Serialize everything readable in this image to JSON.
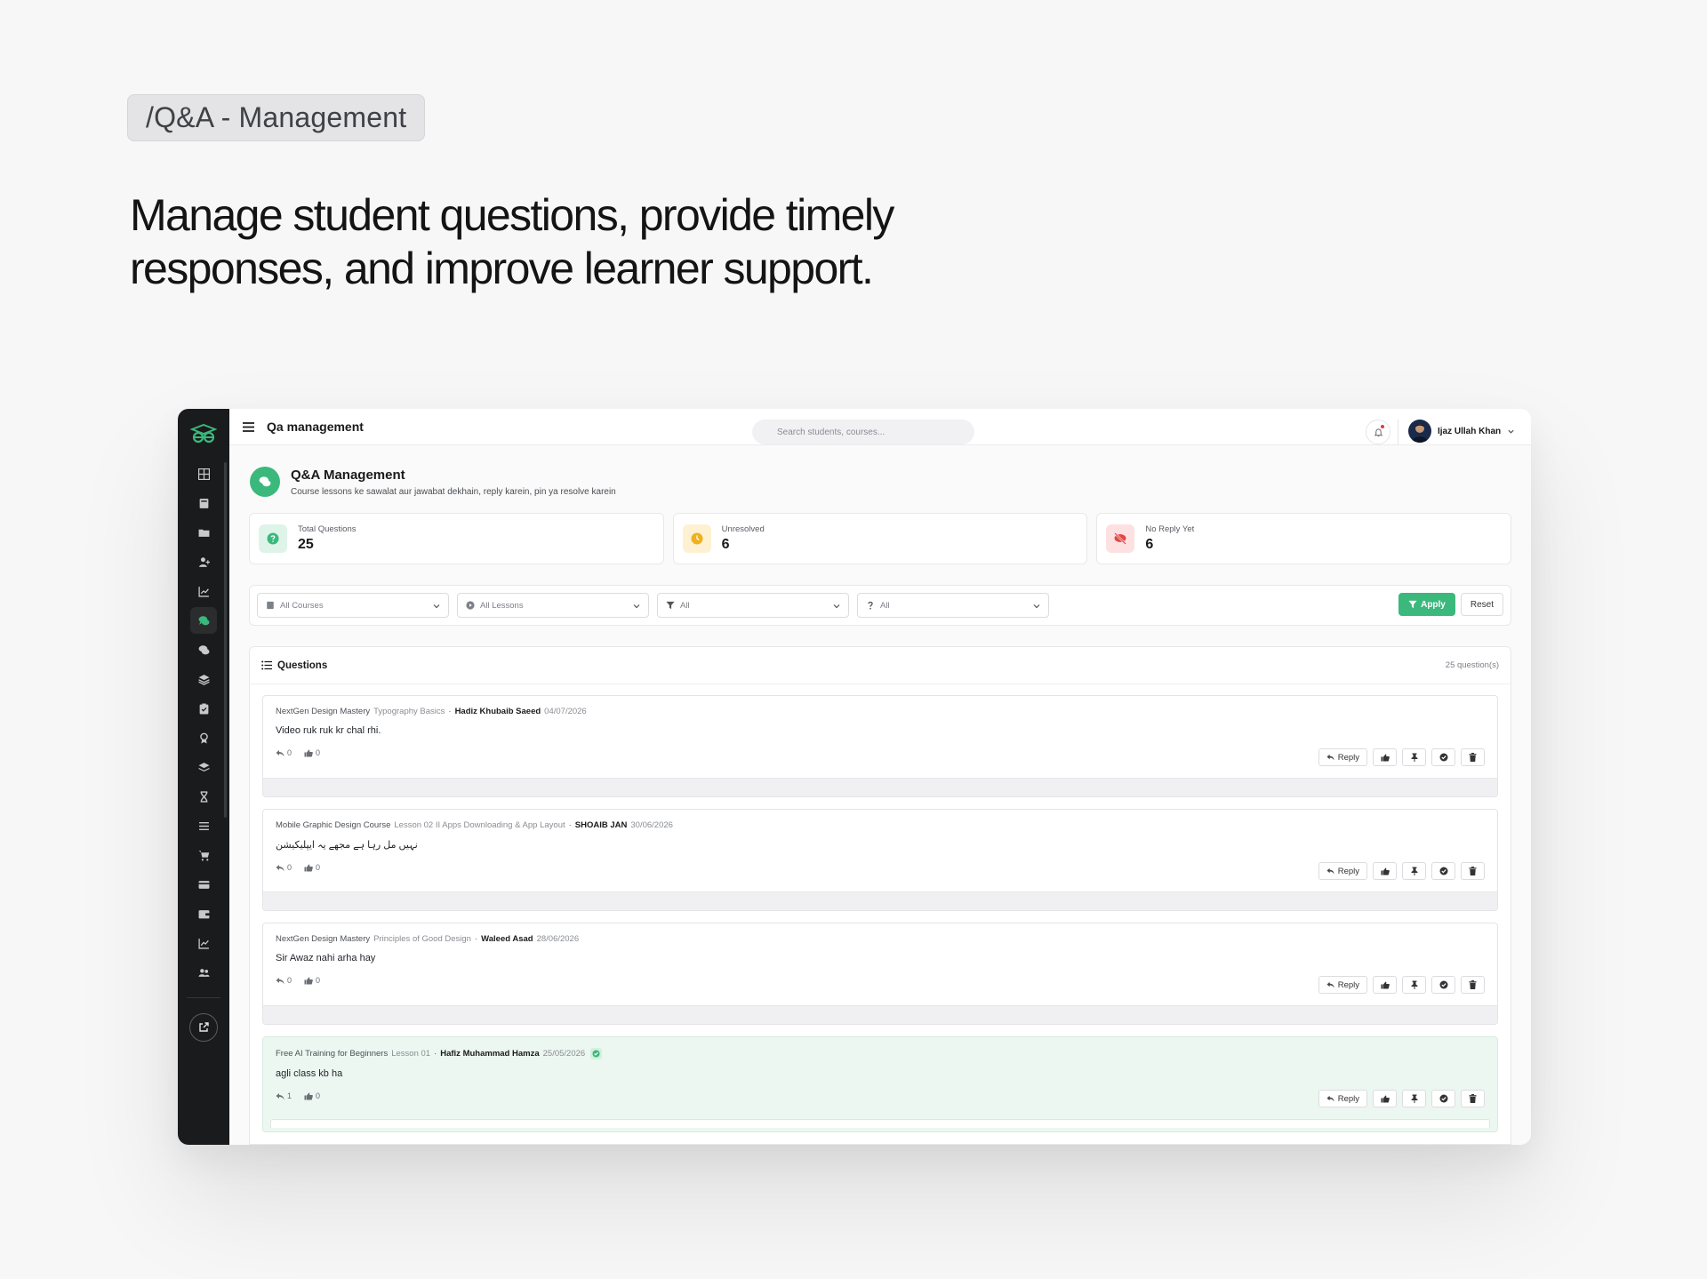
{
  "marketing": {
    "tag": "/Q&A - Management",
    "headline": "Manage student questions, provide timely responses, and improve learner support."
  },
  "topbar": {
    "title": "Qa management",
    "search_placeholder": "Search students, courses...",
    "user_name": "Ijaz Ullah Khan"
  },
  "page": {
    "title": "Q&A Management",
    "subtitle": "Course lessons ke sawalat aur jawabat dekhain, reply karein, pin ya resolve karein"
  },
  "stats": [
    {
      "label": "Total Questions",
      "value": "25"
    },
    {
      "label": "Unresolved",
      "value": "6"
    },
    {
      "label": "No Reply Yet",
      "value": "6"
    }
  ],
  "filters": {
    "course": "All Courses",
    "lesson": "All Lessons",
    "status": "All",
    "reply": "All",
    "apply_label": "Apply",
    "reset_label": "Reset"
  },
  "questions": {
    "title": "Questions",
    "count": "25 question(s)",
    "reply_label": "Reply",
    "items": [
      {
        "course": "NextGen Design Mastery",
        "lesson": "Typography Basics",
        "author": "Hadiz Khubaib Saeed",
        "date": "04/07/2026",
        "text": "Video ruk ruk kr chal rhi.",
        "replies": "0",
        "likes": "0"
      },
      {
        "course": "Mobile Graphic Design Course",
        "lesson": "Lesson 02 II Apps Downloading & App Layout",
        "author": "SHOAIB JAN",
        "date": "30/06/2026",
        "text": "نہیں مل رہا ہے مجھے یہ ایپلیکیشن",
        "replies": "0",
        "likes": "0"
      },
      {
        "course": "NextGen Design Mastery",
        "lesson": "Principles of Good Design",
        "author": "Waleed Asad",
        "date": "28/06/2026",
        "text": "Sir Awaz nahi arha hay",
        "replies": "0",
        "likes": "0"
      },
      {
        "course": "Free AI Training for Beginners",
        "lesson": "Lesson 01",
        "author": "Hafiz Muhammad Hamza",
        "date": "25/05/2026",
        "text": "agli class kb ha",
        "replies": "1",
        "likes": "0"
      }
    ]
  },
  "colors": {
    "accent": "#3bb87c",
    "sidebar": "#1a1b1d",
    "stat_total_bg": "#dff4e9",
    "stat_unresolved_bg": "#fdf1d2",
    "stat_noreply_bg": "#fde1e1"
  }
}
